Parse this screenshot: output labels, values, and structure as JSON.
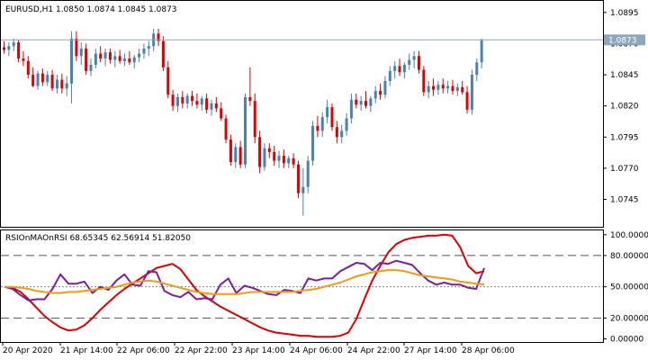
{
  "chart_data": [
    {
      "type": "candlestick",
      "title": "EURUSD,H1  1.0850 1.0874 1.0845 1.0873",
      "symbol": "EURUSD",
      "timeframe": "H1",
      "ohlc": {
        "open": 1.085,
        "high": 1.0874,
        "low": 1.0845,
        "close": 1.0873
      },
      "current_price_label": "1.0873",
      "ylim": [
        1.0723,
        1.0905
      ],
      "y_ticks": [
        "1.0895",
        "1.0870",
        "1.0845",
        "1.0820",
        "1.0795",
        "1.0770",
        "1.0745"
      ],
      "colors": {
        "bull": "#4682b4",
        "bear": "#e00000",
        "price_line": "#8ea6bd"
      },
      "candles": [
        [
          1.0867,
          1.0872,
          1.0862,
          1.0865
        ],
        [
          1.0865,
          1.0871,
          1.086,
          1.0868
        ],
        [
          1.0868,
          1.0874,
          1.0864,
          1.0871
        ],
        [
          1.0871,
          1.0873,
          1.0855,
          1.0858
        ],
        [
          1.0858,
          1.0864,
          1.0852,
          1.0856
        ],
        [
          1.0856,
          1.086,
          1.0842,
          1.0845
        ],
        [
          1.0845,
          1.0851,
          1.0835,
          1.0836
        ],
        [
          1.0836,
          1.0848,
          1.0833,
          1.0846
        ],
        [
          1.0846,
          1.085,
          1.0836,
          1.0839
        ],
        [
          1.0839,
          1.0848,
          1.0836,
          1.0845
        ],
        [
          1.0845,
          1.0849,
          1.0832,
          1.0834
        ],
        [
          1.0834,
          1.0845,
          1.083,
          1.0841
        ],
        [
          1.0841,
          1.0846,
          1.083,
          1.0834
        ],
        [
          1.0834,
          1.0844,
          1.0828,
          1.0838
        ],
        [
          1.0838,
          1.088,
          1.0822,
          1.0874
        ],
        [
          1.0874,
          1.088,
          1.0856,
          1.086
        ],
        [
          1.086,
          1.0871,
          1.0853,
          1.0866
        ],
        [
          1.0866,
          1.087,
          1.0845,
          1.0848
        ],
        [
          1.0848,
          1.0858,
          1.0844,
          1.0853
        ],
        [
          1.0853,
          1.0866,
          1.085,
          1.0862
        ],
        [
          1.0862,
          1.0868,
          1.0855,
          1.0858
        ],
        [
          1.0858,
          1.0866,
          1.0852,
          1.0863
        ],
        [
          1.0863,
          1.0866,
          1.0854,
          1.0857
        ],
        [
          1.0857,
          1.0864,
          1.0851,
          1.086
        ],
        [
          1.086,
          1.0865,
          1.0854,
          1.0856
        ],
        [
          1.0856,
          1.0862,
          1.0852,
          1.0858
        ],
        [
          1.0858,
          1.0864,
          1.0853,
          1.0855
        ],
        [
          1.0855,
          1.0861,
          1.085,
          1.0859
        ],
        [
          1.0859,
          1.0866,
          1.0855,
          1.0862
        ],
        [
          1.0862,
          1.087,
          1.0858,
          1.0866
        ],
        [
          1.0866,
          1.0872,
          1.086,
          1.0868
        ],
        [
          1.0868,
          1.0882,
          1.0864,
          1.0878
        ],
        [
          1.0878,
          1.0882,
          1.0868,
          1.0872
        ],
        [
          1.0872,
          1.0876,
          1.0848,
          1.0851
        ],
        [
          1.0851,
          1.0856,
          1.0826,
          1.0829
        ],
        [
          1.0829,
          1.0833,
          1.0816,
          1.082
        ],
        [
          1.082,
          1.083,
          1.0815,
          1.0827
        ],
        [
          1.0827,
          1.0832,
          1.0818,
          1.0822
        ],
        [
          1.0822,
          1.083,
          1.0818,
          1.0828
        ],
        [
          1.0828,
          1.0832,
          1.082,
          1.0824
        ],
        [
          1.0824,
          1.083,
          1.0818,
          1.0821
        ],
        [
          1.0821,
          1.0828,
          1.0816,
          1.0826
        ],
        [
          1.0826,
          1.083,
          1.0814,
          1.0817
        ],
        [
          1.0817,
          1.0825,
          1.0812,
          1.0822
        ],
        [
          1.0822,
          1.0827,
          1.0815,
          1.0818
        ],
        [
          1.0818,
          1.0823,
          1.0808,
          1.081
        ],
        [
          1.081,
          1.0813,
          1.079,
          1.0793
        ],
        [
          1.0793,
          1.0797,
          1.0772,
          1.0775
        ],
        [
          1.0775,
          1.079,
          1.077,
          1.0787
        ],
        [
          1.0787,
          1.0792,
          1.077,
          1.0773
        ],
        [
          1.0773,
          1.083,
          1.077,
          1.0827
        ],
        [
          1.0827,
          1.0851,
          1.082,
          1.0824
        ],
        [
          1.0824,
          1.083,
          1.079,
          1.0795
        ],
        [
          1.0795,
          1.08,
          1.0766,
          1.0771
        ],
        [
          1.0771,
          1.079,
          1.0768,
          1.0786
        ],
        [
          1.0786,
          1.079,
          1.0778,
          1.0783
        ],
        [
          1.0783,
          1.0788,
          1.0772,
          1.0776
        ],
        [
          1.0776,
          1.0784,
          1.077,
          1.078
        ],
        [
          1.078,
          1.0785,
          1.077,
          1.0774
        ],
        [
          1.0774,
          1.078,
          1.077,
          1.0778
        ],
        [
          1.0778,
          1.0782,
          1.077,
          1.0773
        ],
        [
          1.0773,
          1.0776,
          1.0746,
          1.075
        ],
        [
          1.075,
          1.077,
          1.0732,
          1.0755
        ],
        [
          1.0755,
          1.078,
          1.075,
          1.0776
        ],
        [
          1.0776,
          1.0808,
          1.0772,
          1.0804
        ],
        [
          1.0804,
          1.0812,
          1.0795,
          1.08
        ],
        [
          1.08,
          1.0815,
          1.0795,
          1.0811
        ],
        [
          1.0811,
          1.0825,
          1.0806,
          1.0819
        ],
        [
          1.0819,
          1.0822,
          1.08,
          1.0803
        ],
        [
          1.0803,
          1.0808,
          1.079,
          1.0795
        ],
        [
          1.0795,
          1.0805,
          1.079,
          1.08
        ],
        [
          1.08,
          1.0814,
          1.0796,
          1.081
        ],
        [
          1.081,
          1.083,
          1.0806,
          1.0825
        ],
        [
          1.0825,
          1.083,
          1.0818,
          1.0821
        ],
        [
          1.0821,
          1.0828,
          1.0816,
          1.0824
        ],
        [
          1.0824,
          1.0832,
          1.0818,
          1.082
        ],
        [
          1.082,
          1.0828,
          1.0815,
          1.0826
        ],
        [
          1.0826,
          1.0836,
          1.0822,
          1.0832
        ],
        [
          1.0832,
          1.0838,
          1.0825,
          1.0829
        ],
        [
          1.0829,
          1.0844,
          1.0826,
          1.084
        ],
        [
          1.084,
          1.0852,
          1.0836,
          1.0848
        ],
        [
          1.0848,
          1.0856,
          1.0842,
          1.0852
        ],
        [
          1.0852,
          1.0858,
          1.0844,
          1.0847
        ],
        [
          1.0847,
          1.0855,
          1.0842,
          1.0853
        ],
        [
          1.0853,
          1.0862,
          1.0849,
          1.0857
        ],
        [
          1.0857,
          1.0864,
          1.085,
          1.086
        ],
        [
          1.086,
          1.0864,
          1.0846,
          1.0849
        ],
        [
          1.0849,
          1.0852,
          1.0828,
          1.0831
        ],
        [
          1.0831,
          1.084,
          1.0826,
          1.0836
        ],
        [
          1.0836,
          1.0842,
          1.0828,
          1.0833
        ],
        [
          1.0833,
          1.084,
          1.0829,
          1.0837
        ],
        [
          1.0837,
          1.0842,
          1.083,
          1.0834
        ],
        [
          1.0834,
          1.084,
          1.083,
          1.0836
        ],
        [
          1.0836,
          1.0841,
          1.0829,
          1.0832
        ],
        [
          1.0832,
          1.0838,
          1.0828,
          1.0835
        ],
        [
          1.0835,
          1.084,
          1.0829,
          1.0831
        ],
        [
          1.0831,
          1.0836,
          1.0814,
          1.0817
        ],
        [
          1.0817,
          1.0849,
          1.0813,
          1.0845
        ],
        [
          1.0845,
          1.0858,
          1.084,
          1.0855
        ],
        [
          1.0855,
          1.0874,
          1.085,
          1.0873
        ]
      ]
    },
    {
      "type": "line",
      "title": "RSIOnMAOnRSI 68.65345 62.56914 51.82050",
      "indicator": "RSIOnMAOnRSI",
      "values_label": "68.65345 62.56914 51.82050",
      "ylim": [
        -3,
        105
      ],
      "y_ticks": [
        "100.00000",
        "80.00000",
        "50.00000",
        "20.00000",
        "0.00000"
      ],
      "levels": [
        80,
        50,
        20
      ],
      "x_ticks": [
        "20 Apr 2020",
        "21 Apr 14:00",
        "22 Apr 06:00",
        "22 Apr 22:00",
        "23 Apr 14:00",
        "24 Apr 06:00",
        "24 Apr 22:00",
        "27 Apr 14:00",
        "28 Apr 06:00"
      ],
      "series": [
        {
          "color": "#e00000",
          "values": [
            50,
            49,
            45,
            38,
            30,
            22,
            16,
            11,
            8,
            9,
            13,
            20,
            28,
            35,
            42,
            48,
            53,
            58,
            63,
            68,
            70,
            72,
            67,
            57,
            47,
            41,
            36,
            31,
            27,
            23,
            19,
            15,
            11,
            8,
            6,
            5,
            4,
            3,
            3,
            2,
            2,
            2,
            3,
            6,
            19,
            38,
            56,
            70,
            83,
            91,
            95,
            97,
            98,
            99,
            99,
            100,
            99,
            88,
            70,
            63,
            65
          ]
        },
        {
          "color": "#7b1fa2",
          "values": [
            50,
            48,
            42,
            37,
            38,
            38,
            48,
            62,
            53,
            53,
            55,
            44,
            50,
            47,
            56,
            62,
            52,
            51,
            65,
            64,
            46,
            42,
            40,
            45,
            38,
            39,
            38,
            52,
            58,
            44,
            51,
            49,
            46,
            43,
            42,
            47,
            46,
            44,
            58,
            56,
            58,
            58,
            65,
            69,
            73,
            72,
            66,
            73,
            72,
            75,
            73,
            71,
            63,
            56,
            52,
            54,
            52,
            52,
            49,
            48,
            68
          ]
        },
        {
          "color": "#f39c12",
          "values": [
            50,
            50,
            49,
            48,
            46,
            45,
            44,
            44,
            45,
            45,
            46,
            47,
            48,
            49,
            50,
            52,
            54,
            55,
            56,
            55,
            53,
            51,
            49,
            47,
            45,
            44,
            43,
            43,
            43,
            43,
            44,
            45,
            45,
            45,
            45,
            45,
            45,
            46,
            47,
            48,
            50,
            52,
            54,
            57,
            60,
            62,
            64,
            65,
            66,
            66,
            65,
            63,
            61,
            60,
            59,
            58,
            57,
            55,
            54,
            53,
            52
          ]
        }
      ]
    }
  ]
}
